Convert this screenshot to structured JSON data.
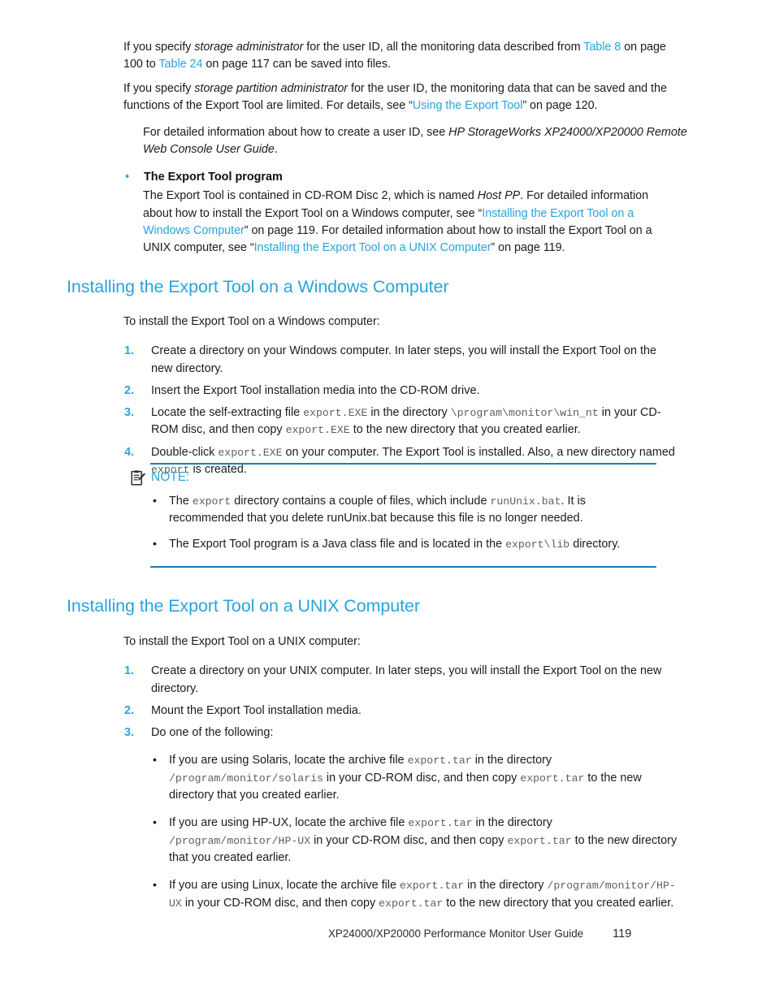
{
  "document": {
    "page_number": "119",
    "footer_title": "XP24000/XP20000 Performance Monitor User Guide"
  },
  "intro": {
    "para1": {
      "seg1": "If you specify ",
      "em1": "storage administrator",
      "seg2": " for the user ID, all the monitoring data described from ",
      "link1": "Table 8",
      "seg3": " on page 100 to ",
      "link2": "Table 24",
      "seg4": " on page 117 can be saved into files."
    },
    "para2": {
      "seg1": "If you specify ",
      "em1": "storage partition administrator",
      "seg2": " for the user ID, the monitoring data that can be saved and the functions of the Export Tool are limited. For details, see “",
      "link1": "Using the Export Tool",
      "seg3": "” on page 120."
    },
    "para3": {
      "seg1": "For detailed information about how to create a user ID, see ",
      "em1": "HP StorageWorks XP24000/XP20000 Remote Web Console User Guide",
      "seg2": "."
    }
  },
  "export_tool_bullet": {
    "bullet_char": "•",
    "title": "The Export Tool program",
    "body": {
      "seg1": "The Export Tool is contained in CD-ROM Disc 2, which is named ",
      "em1": "Host PP",
      "seg2": ". For detailed information about how to install the Export Tool on a Windows computer, see “",
      "link1": "Installing the Export Tool on a Windows Computer",
      "seg3": "” on page 119. For detailed information about how to install the Export Tool on a UNIX computer, see “",
      "link2": "Installing the Export Tool on a UNIX Computer",
      "seg4": "” on page 119."
    }
  },
  "windows_section": {
    "heading": "Installing the Export Tool on a Windows Computer",
    "lead_in": "To install the Export Tool on a Windows computer:",
    "steps": [
      {
        "num": "1.",
        "text": "Create a directory on your Windows computer. In later steps, you will install the Export Tool on the new directory."
      },
      {
        "num": "2.",
        "text": "Insert the Export Tool installation media into the CD-ROM drive."
      },
      {
        "num": "3.",
        "seg1": "Locate the self-extracting file ",
        "code1": "export.EXE",
        "seg2": " in the directory ",
        "code2": "\\program\\monitor\\win_nt",
        "seg3": " in your CD-ROM disc, and then copy ",
        "code3": "export.EXE",
        "seg4": " to the new directory that you created earlier."
      },
      {
        "num": "4.",
        "seg1": "Double-click ",
        "code1": "export.EXE",
        "seg2": " on your computer. The Export Tool is installed. Also, a new directory named ",
        "code2": "export",
        "seg3": " is created."
      }
    ]
  },
  "note": {
    "icon": "note-clipboard-icon",
    "label": "NOTE:",
    "items": [
      {
        "bullet_char": "•",
        "seg1": "The ",
        "code1": "export",
        "seg2": " directory contains a couple of files, which include ",
        "code2": "runUnix.bat",
        "seg3": ". It is recommended that you delete runUnix.bat because this file is no longer needed."
      },
      {
        "bullet_char": "•",
        "seg1": "The Export Tool program is a Java class file and is located in the ",
        "code1": "export\\lib",
        "seg2": " directory."
      }
    ]
  },
  "unix_section": {
    "heading": "Installing the Export Tool on a UNIX Computer",
    "lead_in": "To install the Export Tool on a UNIX computer:",
    "steps": [
      {
        "num": "1.",
        "text": "Create a directory on your UNIX computer. In later steps, you will install the Export Tool on the new directory."
      },
      {
        "num": "2.",
        "text": "Mount the Export Tool installation media."
      },
      {
        "num": "3.",
        "text": "Do one of the following:"
      }
    ],
    "sub_bullets": [
      {
        "bullet_char": "•",
        "seg1": "If you are using Solaris, locate the archive file ",
        "code1": "export.tar",
        "seg2": " in the directory ",
        "code2": "/program/monitor/solaris",
        "seg3": " in your CD-ROM disc, and then copy ",
        "code3": "export.tar",
        "seg4": " to the new directory that you created earlier."
      },
      {
        "bullet_char": "•",
        "seg1": "If you are using HP-UX, locate the archive file ",
        "code1": "export.tar",
        "seg2": " in the directory ",
        "code2": "/program/monitor/HP-UX",
        "seg3": " in your CD-ROM disc, and then copy ",
        "code3": "export.tar",
        "seg4": " to the new directory that you created earlier."
      },
      {
        "bullet_char": "•",
        "seg1": "If you are using Linux, locate the archive file ",
        "code1": "export.tar",
        "seg2": " in the directory ",
        "code2": "/program/monitor/HP-UX",
        "seg3": " in your CD-ROM disc, and then copy ",
        "code3": "export.tar",
        "seg4": " to the new directory that you created earlier."
      }
    ]
  },
  "colors": {
    "link_blue": "#2aa3dd",
    "heading_blue": "#2aa3dd",
    "rule_blue": "#1a7fb8",
    "body_text": "#1c1c1c",
    "code_gray": "#5e5e5e"
  }
}
